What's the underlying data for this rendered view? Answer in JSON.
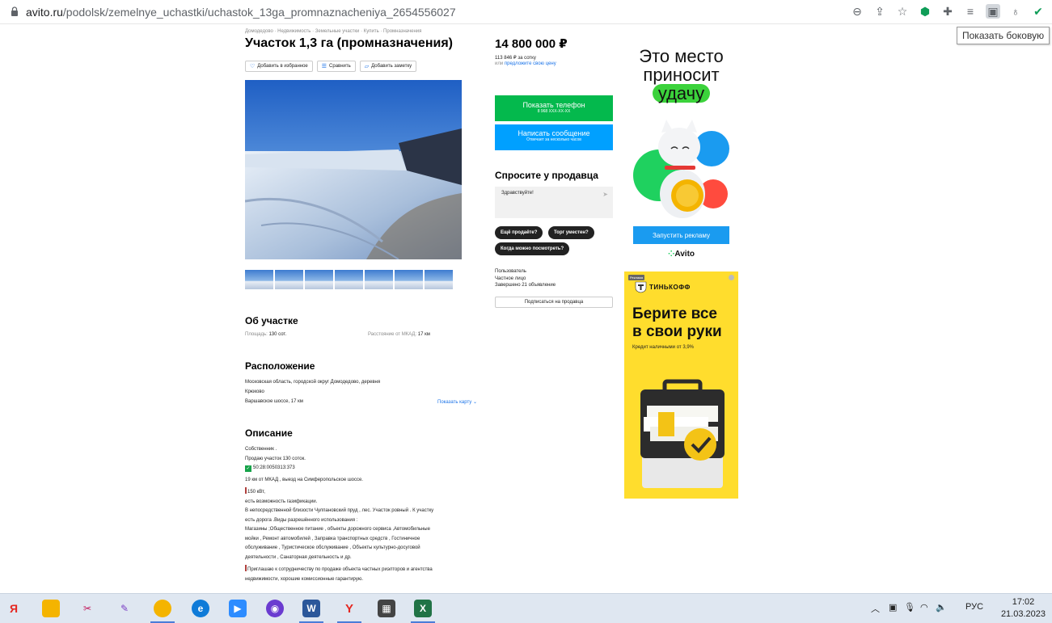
{
  "browser": {
    "url_host": "avito.ru",
    "url_path": "/podolsk/zemelnye_uchastki/uchastok_13ga_promnaznacheniya_2654556027",
    "tooltip": "Показать боковую"
  },
  "listing": {
    "breadcrumbs": "Домодедово · Недвижимость · Земельные участки · Купить · Промназначения",
    "title": "Участок 1,3 га (промназначения)",
    "actions": [
      "Добавить в избранное",
      "Сравнить",
      "Добавить заметку"
    ],
    "price": "14 800 000 ₽",
    "price_per": "113 846 ₽ за сотку",
    "price_offer_prefix": "или",
    "price_offer_link": "предложите свою цену"
  },
  "contact": {
    "phone_label": "Показать телефон",
    "phone_number": "8 968 XXX-XX-XX",
    "message_label": "Написать сообщение",
    "message_sub": "Отвечает за несколько часов",
    "ask_title": "Спросите у продавца",
    "ask_placeholder": "Здравствуйте!",
    "chips": [
      "Ещё продаёте?",
      "Торг уместен?",
      "Когда можно посмотреть?"
    ],
    "seller_name": "Пользователь",
    "seller_type": "Частное лицо",
    "seller_done": "Завершено 21 объявление",
    "subscribe": "Подписаться на продавца"
  },
  "about": {
    "heading": "Об участке",
    "area_label": "Площадь:",
    "area_value": "130 сот.",
    "mkad_label": "Расстояние от МКАД:",
    "mkad_value": "17 км"
  },
  "location": {
    "heading": "Расположение",
    "line1": "Московская область, городской округ Домодедово, деревня",
    "line2": "Крюково",
    "line3": "Варшавское шоссе, 17 км",
    "map_link": "Показать карту"
  },
  "description": {
    "heading": "Описание",
    "lines": [
      "Собственник .",
      "Продаю участок 130 соток.",
      "50:28:0050313:373",
      "19 км от МКАД , выезд на Симферопольское шоссе.",
      "150 кВт,",
      "есть возможность газификации.",
      "В непосредственной близости Чулпановский пруд , лес. Участок ровный . К участку",
      "есть дорога .Виды разрешённого использования :",
      "Магазины ;Общественное питание , объекты дорожного сервиса ,Автомобильные",
      "мойки , Ремонт автомобилей , Заправка транспортных средств , Гостиничное",
      "обслуживание , Туристическое обслуживание , Объекты культурно-досуговой",
      "деятельности , Санаторная деятельность и др.",
      "Приглашаю к сотрудничеству по продаже объекта частных риэлторов и агентства",
      "недвижимости, хорошие комиссионные гарантирую."
    ]
  },
  "ad1": {
    "line1": "Это место",
    "line2": "приносит",
    "line3": "удачу",
    "button": "Запустить рекламу",
    "logo": "Avito"
  },
  "ad2": {
    "tag": "Реклама",
    "brand": "ТИНЬКОФФ",
    "headline1": "Берите все",
    "headline2": "в свои руки",
    "sub": "Кредит наличными от 3,9%"
  },
  "taskbar": {
    "lang": "РУС",
    "time": "17:02",
    "date": "21.03.2023"
  },
  "colors": {
    "green_button": "#04b94d",
    "blue_button": "#00a0ff",
    "ad_yellow": "#ffdd2d"
  }
}
